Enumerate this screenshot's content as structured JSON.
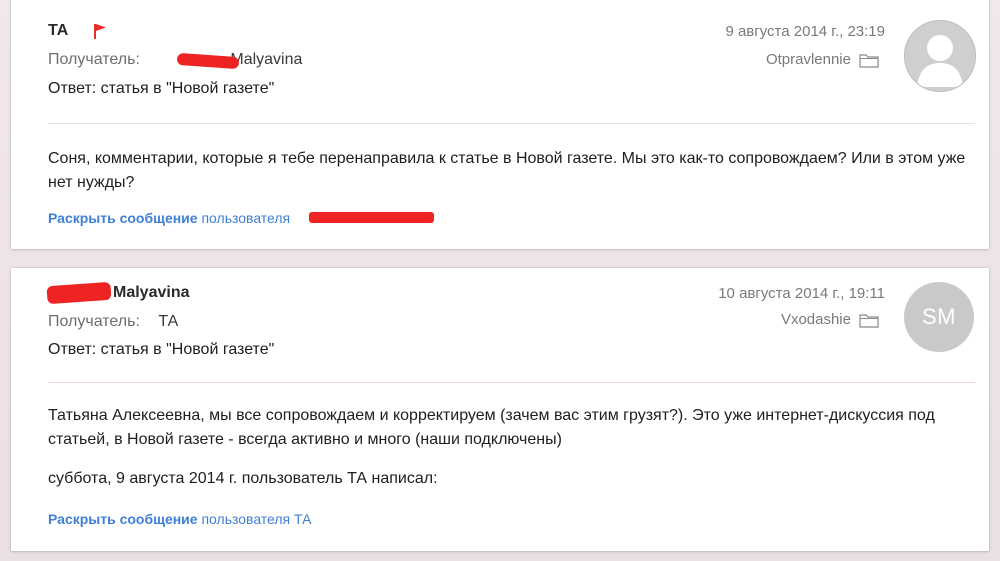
{
  "messages": [
    {
      "sender": "ТА",
      "recipient_label": "Получатель:",
      "recipient_visible": "Malyavina",
      "subject": "Ответ: статья в \"Новой газете\"",
      "date": "9 августа 2014 г., 23:19",
      "folder": "Otpravlennie",
      "avatar": "person-silhouette-icon",
      "body": "Соня, комментарии, которые я тебе перенаправила к статье в Новой газете. Мы это как-то сопровождаем? Или в этом уже нет нужды?",
      "expand_bold": "Раскрыть сообщение",
      "expand_rest": "пользователя",
      "flag_color": "#e8302a"
    },
    {
      "sender_visible": "Malyavina",
      "recipient_label": "Получатель:",
      "recipient": "ТА",
      "subject": "Ответ: статья в \"Новой газете\"",
      "date": "10 августа 2014 г., 19:11",
      "folder": "Vxodashie",
      "avatar_initials": "SM",
      "body_p1": "Татьяна Алексеевна, мы все сопровождаем и корректируем (зачем вас этим грузят?). Это уже интернет-дискуссия под статьей, в Новой газете - всегда активно и много (наши подключены)",
      "body_p2": "суббота, 9 августа 2014 г. пользователь ТА написал:",
      "expand_bold": "Раскрыть сообщение",
      "expand_rest": "пользователя ТА"
    }
  ],
  "colors": {
    "link": "#3f7fd6",
    "redaction": "#ee2424",
    "avatar_bg": "#c9c9c9"
  }
}
